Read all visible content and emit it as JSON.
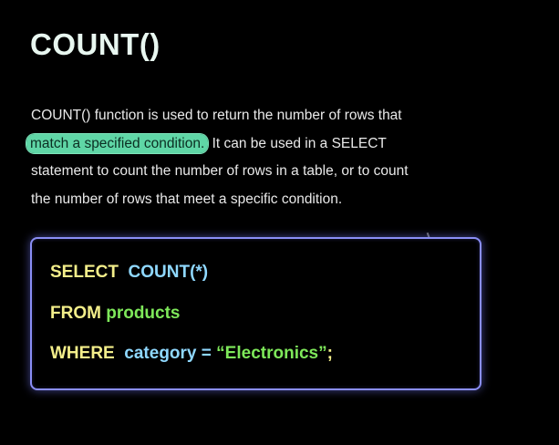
{
  "heading": "COUNT()",
  "description": {
    "line1": "COUNT() function is used to return the number of rows that",
    "highlight": "match a specified condition.",
    "line2_rest": " It can be used in a SELECT",
    "line3": "statement to count the number of rows in a table, or to count",
    "line4": "the number of rows that meet a specific condition."
  },
  "code": {
    "select_kw": "SELECT",
    "select_expr": "COUNT(*)",
    "from_kw": "FROM",
    "table": "products",
    "where_kw": "WHERE",
    "column": "category",
    "operator": "=",
    "value": "“Electronics”",
    "terminator": ";"
  },
  "colors": {
    "background": "#000000",
    "heading": "#e8f7f0",
    "highlight": "#5fd6a6",
    "keyword": "#f3ee8a",
    "function": "#8fd8ff",
    "identifier": "#7ee85a",
    "box_border": "#8a8ef5"
  }
}
